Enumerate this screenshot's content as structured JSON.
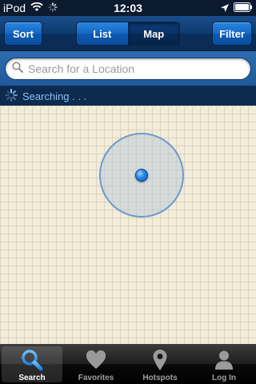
{
  "status_bar": {
    "carrier": "iPod",
    "time": "12:03"
  },
  "nav_bar": {
    "sort_label": "Sort",
    "filter_label": "Filter",
    "segments": [
      {
        "label": "List",
        "active": false
      },
      {
        "label": "Map",
        "active": true
      }
    ]
  },
  "search": {
    "placeholder": "Search for a Location",
    "value": ""
  },
  "searching_status": "Searching . . .",
  "tabs": [
    {
      "label": "Search",
      "icon": "search-icon",
      "active": true
    },
    {
      "label": "Favorites",
      "icon": "heart-icon",
      "active": false
    },
    {
      "label": "Hotspots",
      "icon": "map-pin-icon",
      "active": false
    },
    {
      "label": "Log In",
      "icon": "person-icon",
      "active": false
    }
  ],
  "colors": {
    "nav_blue": "#0f3a6e",
    "button_blue": "#1567c4",
    "map_background": "#f2ecd8",
    "location_dot": "#2a8ae8"
  }
}
